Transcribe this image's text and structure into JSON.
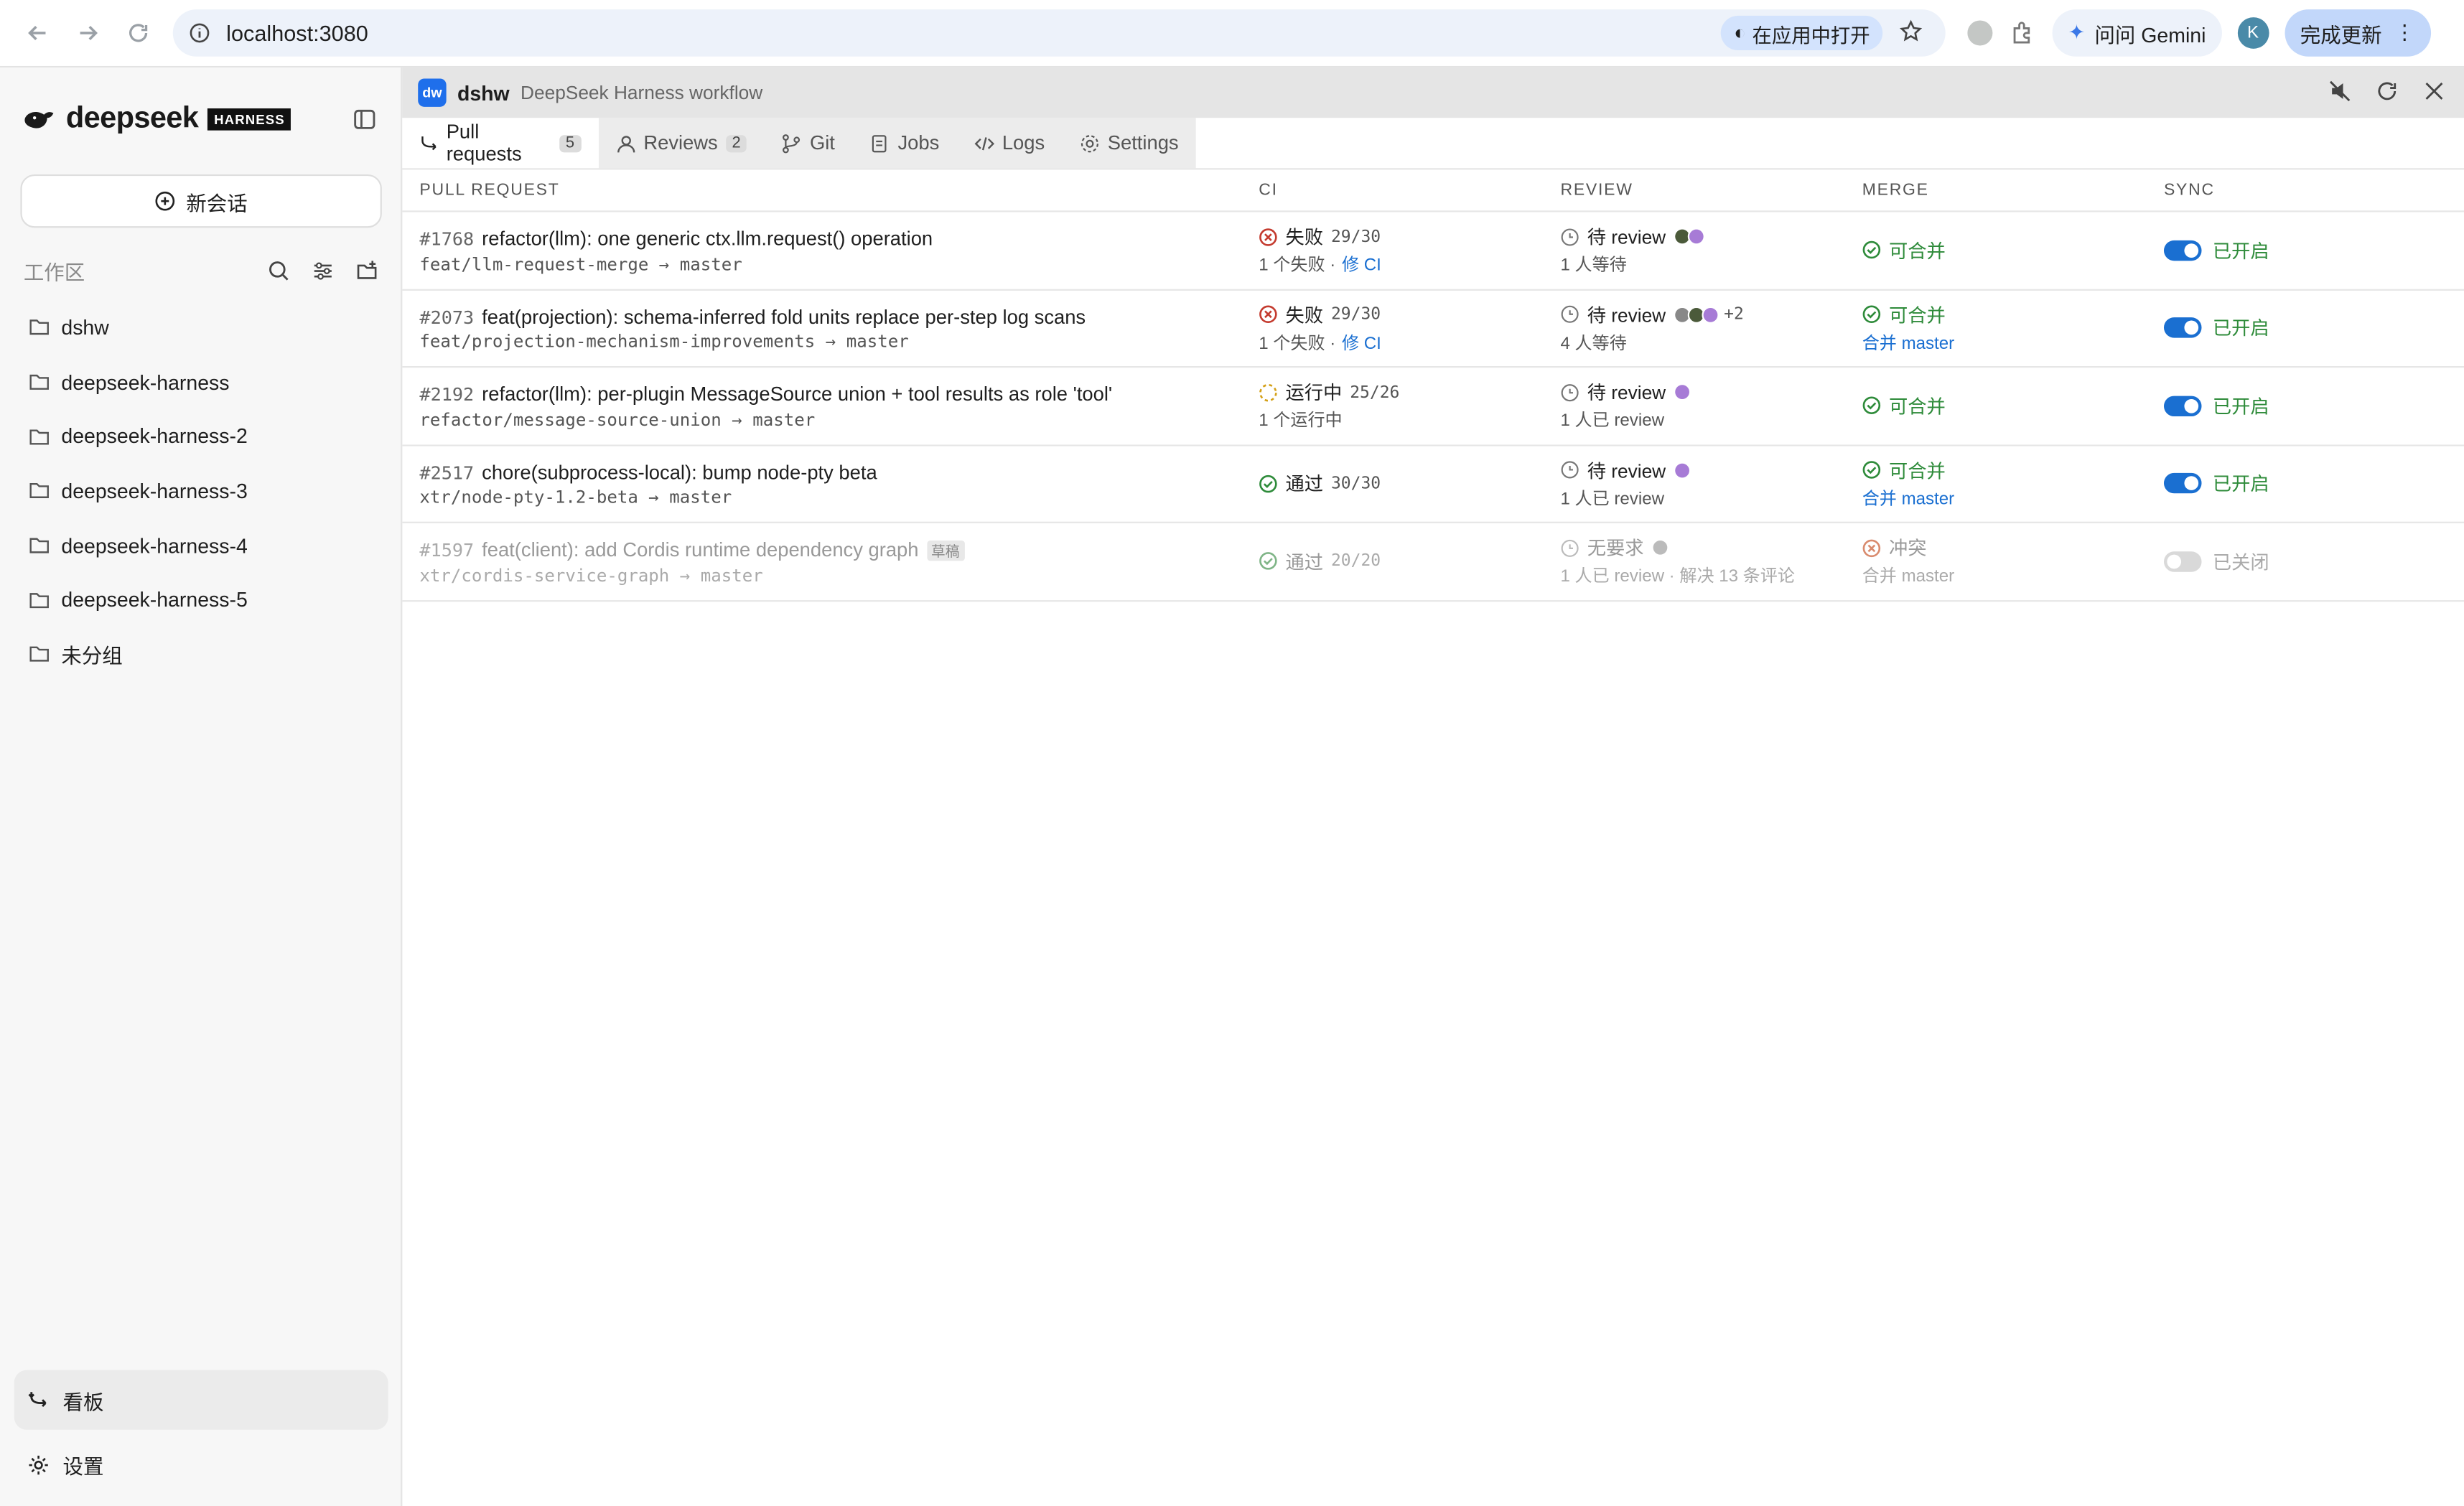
{
  "browser": {
    "url": "localhost:3080",
    "open_in_app": "在应用中打开",
    "gemini": "问问 Gemini",
    "profile_initial": "K",
    "update": "完成更新"
  },
  "sidebar": {
    "brand": "deepseek",
    "brand_badge": "HARNESS",
    "new_chat": "新会话",
    "workspace_label": "工作区",
    "workspaces": [
      {
        "label": "dshw"
      },
      {
        "label": "deepseek-harness"
      },
      {
        "label": "deepseek-harness-2"
      },
      {
        "label": "deepseek-harness-3"
      },
      {
        "label": "deepseek-harness-4"
      },
      {
        "label": "deepseek-harness-5"
      },
      {
        "label": "未分组"
      }
    ],
    "board": "看板",
    "settings": "设置"
  },
  "main": {
    "logo": "dw",
    "title": "dshw",
    "subtitle": "DeepSeek Harness workflow",
    "tabs": [
      {
        "label": "Pull requests",
        "count": "5"
      },
      {
        "label": "Reviews",
        "count": "2"
      },
      {
        "label": "Git"
      },
      {
        "label": "Jobs"
      },
      {
        "label": "Logs"
      },
      {
        "label": "Settings"
      }
    ],
    "columns": {
      "pr": "PULL REQUEST",
      "ci": "CI",
      "review": "REVIEW",
      "merge": "MERGE",
      "sync": "SYNC"
    },
    "rows": [
      {
        "num": "#1768",
        "title": "refactor(llm): one generic ctx.llm.request() operation",
        "branch": "feat/llm-request-merge → master",
        "ci": "失败",
        "ci_frac": "29/30",
        "ci_sub": "1 个失败 ·",
        "ci_link": "修 CI",
        "review": "待 review",
        "review_sub": "1 人等待",
        "merge": "可合并",
        "merge_sub": "",
        "sync": "已开启"
      },
      {
        "num": "#2073",
        "title": "feat(projection): schema-inferred fold units replace per-step log scans",
        "branch": "feat/projection-mechanism-improvements → master",
        "ci": "失败",
        "ci_frac": "29/30",
        "ci_sub": "1 个失败 ·",
        "ci_link": "修 CI",
        "review": "待 review",
        "review_extra": "+2",
        "review_sub": "4 人等待",
        "merge": "可合并",
        "merge_sub": "合并 master",
        "sync": "已开启"
      },
      {
        "num": "#2192",
        "title": "refactor(llm): per-plugin MessageSource union + tool results as role 'tool'",
        "branch": "refactor/message-source-union → master",
        "ci": "运行中",
        "ci_frac": "25/26",
        "ci_sub": "1 个运行中",
        "review": "待 review",
        "review_sub": "1 人已 review",
        "merge": "可合并",
        "merge_sub": "",
        "sync": "已开启"
      },
      {
        "num": "#2517",
        "title": "chore(subprocess-local): bump node-pty beta",
        "branch": "xtr/node-pty-1.2-beta → master",
        "ci": "通过",
        "ci_frac": "30/30",
        "ci_sub": "",
        "review": "待 review",
        "review_sub": "1 人已 review",
        "merge": "可合并",
        "merge_sub": "合并 master",
        "sync": "已开启"
      },
      {
        "num": "#1597",
        "title": "feat(client): add Cordis runtime dependency graph",
        "draft": "草稿",
        "branch": "xtr/cordis-service-graph → master",
        "ci": "通过",
        "ci_frac": "20/20",
        "ci_sub": "",
        "review": "无要求",
        "review_sub": "1 人已 review · 解决 13 条评论",
        "merge": "冲突",
        "merge_sub": "合并 master",
        "sync": "已关闭"
      }
    ]
  },
  "colors": {
    "accent": "#1a6fd1",
    "fail": "#c43b2f",
    "ok": "#2e8b3a"
  }
}
